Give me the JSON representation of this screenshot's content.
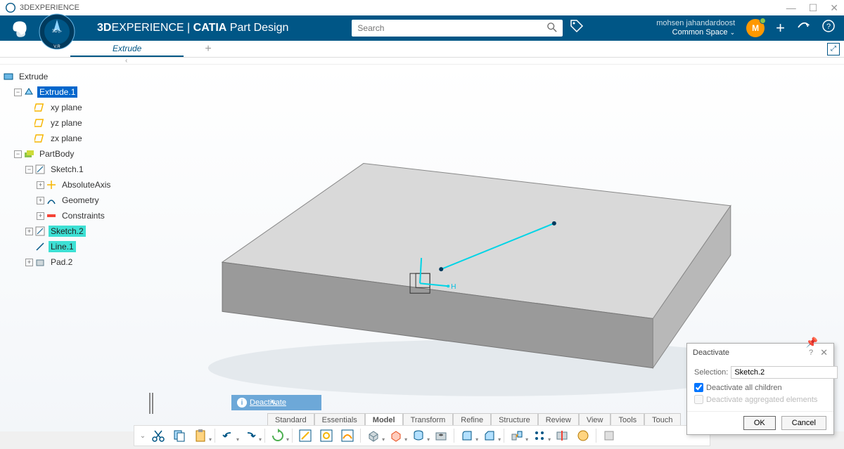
{
  "titlebar": {
    "app_name": "3DEXPERIENCE"
  },
  "header": {
    "brand_bold": "3D",
    "brand_light": "EXPERIENCE",
    "brand_sep": " | ",
    "brand_app": "CATIA",
    "brand_sub": " Part Design",
    "search_placeholder": "Search",
    "user_name": "mohsen jahandardoost",
    "space_label": "Common Space",
    "avatar_initial": "M"
  },
  "tabs": {
    "active": "Extrude"
  },
  "tree": {
    "root": "Extrude",
    "items": [
      {
        "label": "Extrude.1",
        "sel": "blue"
      },
      {
        "label": "xy plane"
      },
      {
        "label": "yz plane"
      },
      {
        "label": "zx plane"
      },
      {
        "label": "PartBody"
      },
      {
        "label": "Sketch.1"
      },
      {
        "label": "AbsoluteAxis"
      },
      {
        "label": "Geometry"
      },
      {
        "label": "Constraints"
      },
      {
        "label": "Sketch.2",
        "sel": "cyan"
      },
      {
        "label": "Line.1",
        "sel": "cyan"
      },
      {
        "label": "Pad.2"
      }
    ]
  },
  "status_tip": "Deactivate",
  "bottom_tabs": [
    "Standard",
    "Essentials",
    "Model",
    "Transform",
    "Refine",
    "Structure",
    "Review",
    "View",
    "Tools",
    "Touch"
  ],
  "bottom_tabs_active_index": 2,
  "dialog": {
    "title": "Deactivate",
    "selection_label": "Selection:",
    "selection_value": "Sketch.2",
    "check1": "Deactivate all children",
    "check1_checked": true,
    "check2": "Deactivate aggregated elements",
    "check2_checked": false,
    "ok": "OK",
    "cancel": "Cancel"
  }
}
